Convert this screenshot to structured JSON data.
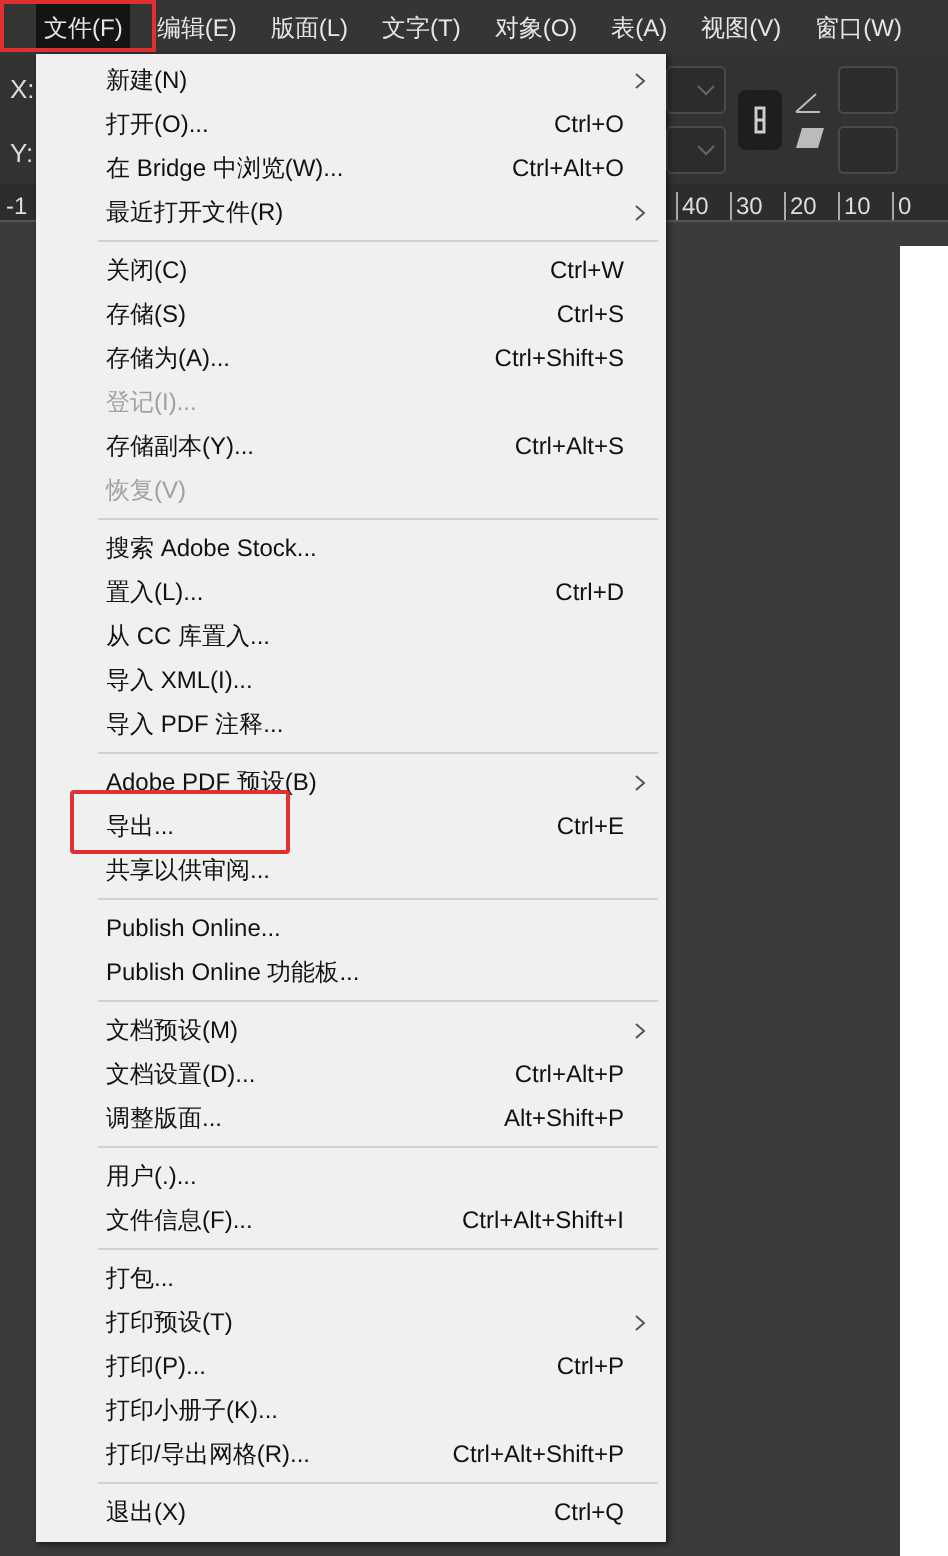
{
  "menu_bar": [
    {
      "label": "文件(F)",
      "selected": true,
      "marked": true
    },
    {
      "label": "编辑(E)",
      "selected": false,
      "marked": false
    },
    {
      "label": "版面(L)",
      "selected": false,
      "marked": false
    },
    {
      "label": "文字(T)",
      "selected": false,
      "marked": false
    },
    {
      "label": "对象(O)",
      "selected": false,
      "marked": false
    },
    {
      "label": "表(A)",
      "selected": false,
      "marked": false
    },
    {
      "label": "视图(V)",
      "selected": false,
      "marked": false
    },
    {
      "label": "窗口(W)",
      "selected": false,
      "marked": false
    }
  ],
  "control_panel": {
    "x_label": "X:",
    "y_label": "Y:"
  },
  "ruler": {
    "left_label": "-1",
    "labels": [
      "40",
      "30",
      "20",
      "10",
      "0"
    ]
  },
  "file_menu": [
    [
      {
        "label": "新建(N)",
        "submenu": true,
        "disabled": false,
        "marked": false
      },
      {
        "label": "打开(O)...",
        "shortcut": "Ctrl+O",
        "submenu": false,
        "disabled": false,
        "marked": false
      },
      {
        "label": "在 Bridge 中浏览(W)...",
        "shortcut": "Ctrl+Alt+O",
        "submenu": false,
        "disabled": false,
        "marked": false
      },
      {
        "label": "最近打开文件(R)",
        "submenu": true,
        "disabled": false,
        "marked": false
      }
    ],
    [
      {
        "label": "关闭(C)",
        "shortcut": "Ctrl+W",
        "submenu": false,
        "disabled": false,
        "marked": false
      },
      {
        "label": "存储(S)",
        "shortcut": "Ctrl+S",
        "submenu": false,
        "disabled": false,
        "marked": false
      },
      {
        "label": "存储为(A)...",
        "shortcut": "Ctrl+Shift+S",
        "submenu": false,
        "disabled": false,
        "marked": false
      },
      {
        "label": "登记(I)...",
        "submenu": false,
        "disabled": true,
        "marked": false
      },
      {
        "label": "存储副本(Y)...",
        "shortcut": "Ctrl+Alt+S",
        "submenu": false,
        "disabled": false,
        "marked": false
      },
      {
        "label": "恢复(V)",
        "submenu": false,
        "disabled": true,
        "marked": false
      }
    ],
    [
      {
        "label": "搜索 Adobe Stock...",
        "submenu": false,
        "disabled": false,
        "marked": false
      },
      {
        "label": "置入(L)...",
        "shortcut": "Ctrl+D",
        "submenu": false,
        "disabled": false,
        "marked": false
      },
      {
        "label": "从 CC 库置入...",
        "submenu": false,
        "disabled": false,
        "marked": false
      },
      {
        "label": "导入 XML(I)...",
        "submenu": false,
        "disabled": false,
        "marked": false
      },
      {
        "label": "导入 PDF 注释...",
        "submenu": false,
        "disabled": false,
        "marked": false
      }
    ],
    [
      {
        "label": "Adobe PDF 预设(B)",
        "submenu": true,
        "disabled": false,
        "marked": false
      },
      {
        "label": "导出...",
        "shortcut": "Ctrl+E",
        "submenu": false,
        "disabled": false,
        "marked": true
      },
      {
        "label": "共享以供审阅...",
        "submenu": false,
        "disabled": false,
        "marked": false
      }
    ],
    [
      {
        "label": "Publish Online...",
        "submenu": false,
        "disabled": false,
        "marked": false
      },
      {
        "label": "Publish Online 功能板...",
        "submenu": false,
        "disabled": false,
        "marked": false
      }
    ],
    [
      {
        "label": "文档预设(M)",
        "submenu": true,
        "disabled": false,
        "marked": false
      },
      {
        "label": "文档设置(D)...",
        "shortcut": "Ctrl+Alt+P",
        "submenu": false,
        "disabled": false,
        "marked": false
      },
      {
        "label": "调整版面...",
        "shortcut": "Alt+Shift+P",
        "submenu": false,
        "disabled": false,
        "marked": false
      }
    ],
    [
      {
        "label": "用户(.)...",
        "submenu": false,
        "disabled": false,
        "marked": false
      },
      {
        "label": "文件信息(F)...",
        "shortcut": "Ctrl+Alt+Shift+I",
        "submenu": false,
        "disabled": false,
        "marked": false
      }
    ],
    [
      {
        "label": "打包...",
        "submenu": false,
        "disabled": false,
        "marked": false
      },
      {
        "label": "打印预设(T)",
        "submenu": true,
        "disabled": false,
        "marked": false
      },
      {
        "label": "打印(P)...",
        "shortcut": "Ctrl+P",
        "submenu": false,
        "disabled": false,
        "marked": false
      },
      {
        "label": "打印小册子(K)...",
        "submenu": false,
        "disabled": false,
        "marked": false
      },
      {
        "label": "打印/导出网格(R)...",
        "shortcut": "Ctrl+Alt+Shift+P",
        "submenu": false,
        "disabled": false,
        "marked": false
      }
    ],
    [
      {
        "label": "退出(X)",
        "shortcut": "Ctrl+Q",
        "submenu": false,
        "disabled": false,
        "marked": false
      }
    ]
  ]
}
